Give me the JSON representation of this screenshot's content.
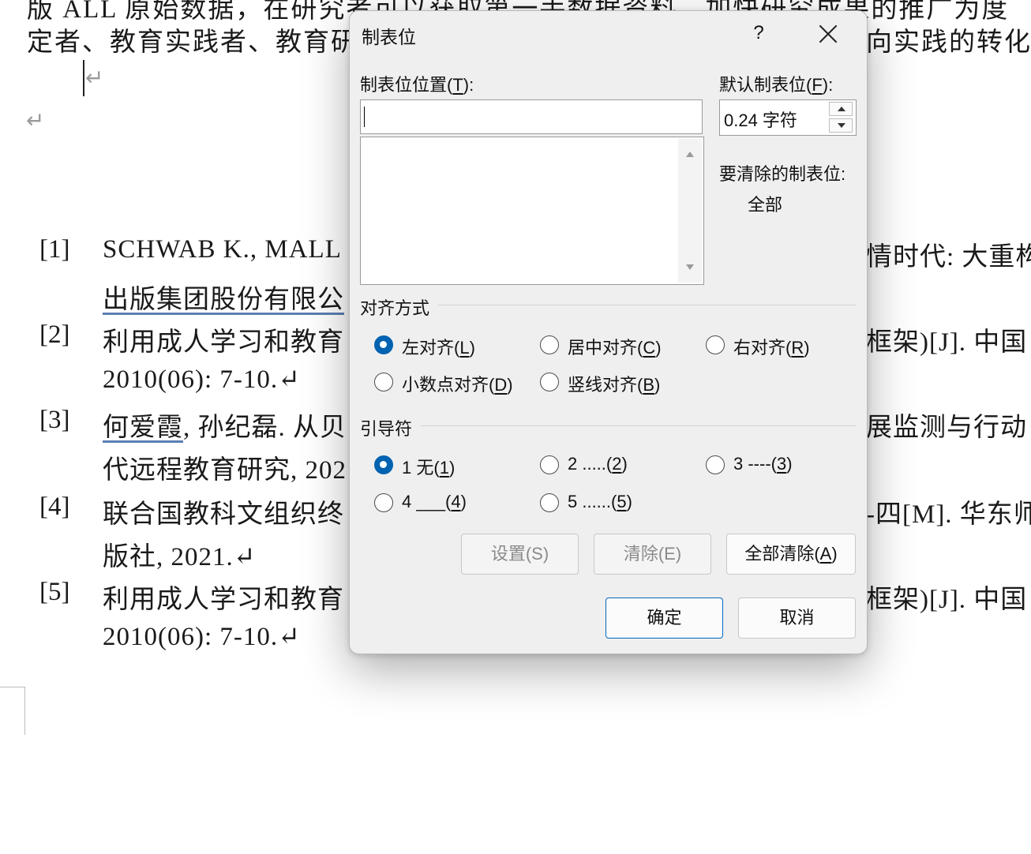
{
  "document": {
    "top_line_1": "版 ALL 原始数据，在研究者可以获取第一手数据资料，加快研究成果的推广为度",
    "top_line_2_left": "定者、教育实践者、教育研",
    "top_line_2_right": "向实践的转化",
    "para_mark": "↵",
    "references": [
      {
        "num": "[1]",
        "l1_left": "SCHWAB K., MALL",
        "l1_right": "情时代: 大重构",
        "l2": "出版集团股份有限公"
      },
      {
        "num": "[2]",
        "l1_left": "利用成人学习和教育",
        "l1_right": "框架)[J]. 中国",
        "l2": "2010(06): 7-10.↵"
      },
      {
        "num": "[3]",
        "l1_left_ul": "何爱霞",
        "l1_left_rest": ", 孙纪磊. 从贝",
        "l1_right": "展监测与行动",
        "l2": "代远程教育研究, 202"
      },
      {
        "num": "[4]",
        "l1_left": "联合国教科文组织终",
        "l1_right": "-四[M]. 华东师",
        "l2": "版社, 2021.↵"
      },
      {
        "num": "[5]",
        "l1_left": "利用成人学习和教育",
        "l1_right": "框架)[J]. 中国",
        "l2": "2010(06): 7-10.↵"
      }
    ]
  },
  "dialog": {
    "title": "制表位",
    "help": "?",
    "tab_position_label": "制表位位置(",
    "tab_position_key": "T",
    "tab_position_value": "",
    "default_tab_label": "默认制表位(",
    "default_tab_key": "F",
    "default_tab_value": "0.24 字符",
    "clear_label": "要清除的制表位:",
    "clear_value": "全部",
    "alignment": {
      "title": "对齐方式",
      "options": [
        {
          "text": "左对齐(",
          "key": "L",
          "checked": true
        },
        {
          "text": "居中对齐(",
          "key": "C",
          "checked": false
        },
        {
          "text": "右对齐(",
          "key": "R",
          "checked": false
        },
        {
          "text": "小数点对齐(",
          "key": "D",
          "checked": false
        },
        {
          "text": "竖线对齐(",
          "key": "B",
          "checked": false
        }
      ]
    },
    "leader": {
      "title": "引导符",
      "options": [
        {
          "text": "1 无(",
          "key": "1",
          "checked": true
        },
        {
          "text": "2 .....(",
          "key": "2",
          "checked": false
        },
        {
          "text": "3 ----(",
          "key": "3",
          "checked": false
        },
        {
          "text": "4 ___(",
          "key": "4",
          "checked": false
        },
        {
          "text": "5 ......(",
          "key": "5",
          "checked": false
        }
      ]
    },
    "buttons": {
      "set": "设置(S)",
      "clear": "清除(E)",
      "clear_all": "全部清除(",
      "clear_all_key": "A",
      "ok": "确定",
      "cancel": "取消"
    }
  },
  "colors": {
    "accent": "#0063b1",
    "dialog_bg": "#efefef"
  }
}
